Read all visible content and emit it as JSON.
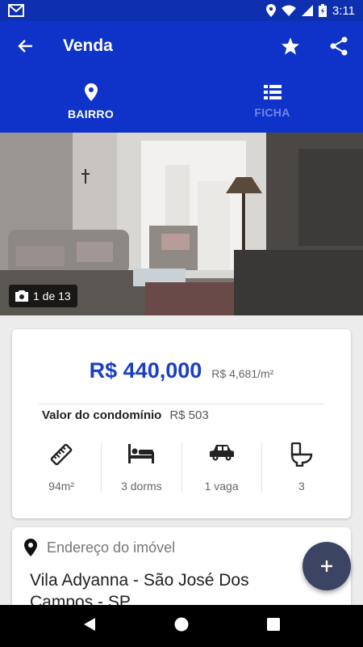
{
  "status_bar": {
    "time": "3:11",
    "icons": [
      "gmail-icon",
      "location-icon",
      "wifi-icon",
      "signal-icon",
      "battery-icon"
    ]
  },
  "app_bar": {
    "title": "Venda",
    "icons": [
      "back-arrow-icon",
      "star-icon",
      "share-icon"
    ]
  },
  "tabs": [
    {
      "label": "BAIRRO",
      "icon": "location-pin-icon",
      "active": true
    },
    {
      "label": "FICHA",
      "icon": "list-icon",
      "active": false
    }
  ],
  "photo": {
    "counter": "1 de 13"
  },
  "price_card": {
    "price": "R$ 440,000",
    "price_per_m2": "R$ 4,681/m²",
    "condo_label": "Valor do condomínio",
    "condo_value": "R$ 503",
    "features": [
      {
        "icon": "ruler-icon",
        "value": "94m²"
      },
      {
        "icon": "bed-icon",
        "value": "3 dorms"
      },
      {
        "icon": "car-icon",
        "value": "1 vaga"
      },
      {
        "icon": "toilet-icon",
        "value": "3"
      }
    ]
  },
  "address_card": {
    "label": "Endereço do imóvel",
    "address": "Vila Adyanna - São José Dos Campos - SP"
  },
  "fab": {
    "symbol": "+"
  },
  "colors": {
    "primary": "#0f33c9",
    "status_bar": "#0d2fb0",
    "price": "#1b3fc2",
    "fab": "#3c4464"
  }
}
